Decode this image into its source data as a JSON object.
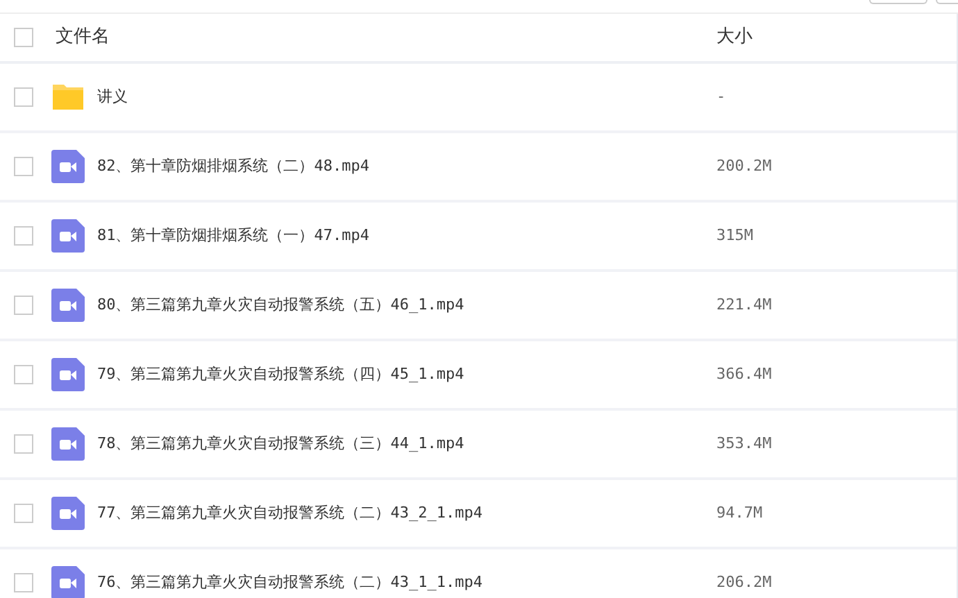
{
  "header": {
    "name": "文件名",
    "size": "大小",
    "checked": false
  },
  "files": [
    {
      "kind": "folder",
      "name": "讲义",
      "size": "-",
      "checked": false
    },
    {
      "kind": "video",
      "name": "82、第十章防烟排烟系统（二）48.mp4",
      "size": "200.2M",
      "checked": false
    },
    {
      "kind": "video",
      "name": "81、第十章防烟排烟系统（一）47.mp4",
      "size": "315M",
      "checked": false
    },
    {
      "kind": "video",
      "name": "80、第三篇第九章火灾自动报警系统（五）46_1.mp4",
      "size": "221.4M",
      "checked": false
    },
    {
      "kind": "video",
      "name": "79、第三篇第九章火灾自动报警系统（四）45_1.mp4",
      "size": "366.4M",
      "checked": false
    },
    {
      "kind": "video",
      "name": "78、第三篇第九章火灾自动报警系统（三）44_1.mp4",
      "size": "353.4M",
      "checked": false
    },
    {
      "kind": "video",
      "name": "77、第三篇第九章火灾自动报警系统（二）43_2_1.mp4",
      "size": "94.7M",
      "checked": false
    },
    {
      "kind": "video",
      "name": "76、第三篇第九章火灾自动报警系统（二）43_1_1.mp4",
      "size": "206.2M",
      "checked": false
    }
  ]
}
